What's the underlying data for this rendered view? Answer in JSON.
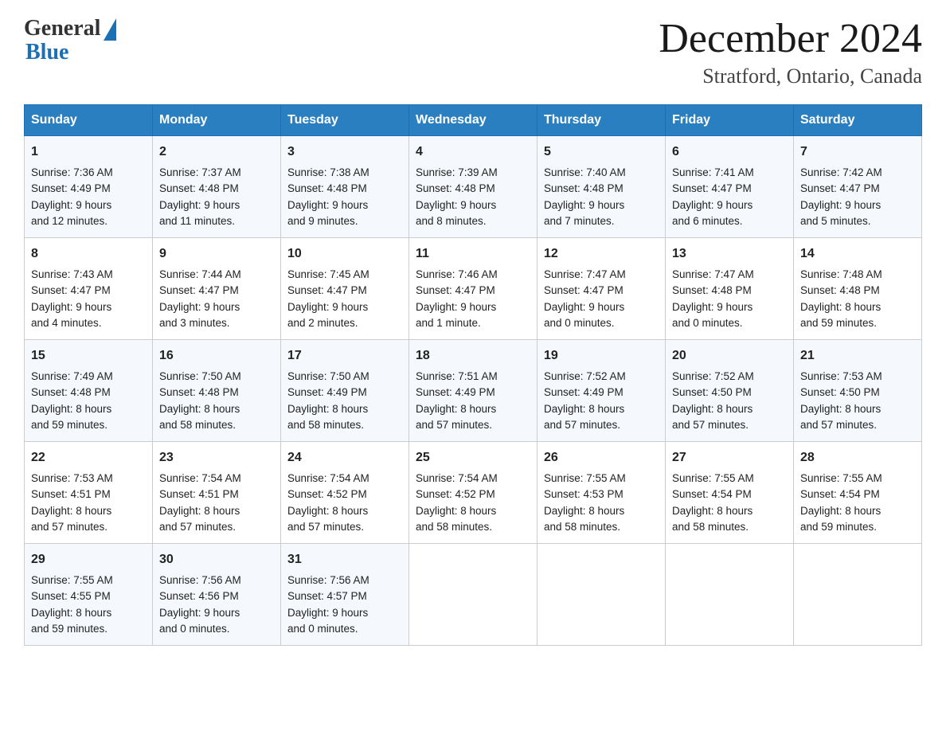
{
  "logo": {
    "general": "General",
    "blue": "Blue"
  },
  "title": {
    "month_year": "December 2024",
    "location": "Stratford, Ontario, Canada"
  },
  "days_of_week": [
    "Sunday",
    "Monday",
    "Tuesday",
    "Wednesday",
    "Thursday",
    "Friday",
    "Saturday"
  ],
  "weeks": [
    [
      {
        "day": "1",
        "sunrise": "7:36 AM",
        "sunset": "4:49 PM",
        "daylight": "9 hours and 12 minutes."
      },
      {
        "day": "2",
        "sunrise": "7:37 AM",
        "sunset": "4:48 PM",
        "daylight": "9 hours and 11 minutes."
      },
      {
        "day": "3",
        "sunrise": "7:38 AM",
        "sunset": "4:48 PM",
        "daylight": "9 hours and 9 minutes."
      },
      {
        "day": "4",
        "sunrise": "7:39 AM",
        "sunset": "4:48 PM",
        "daylight": "9 hours and 8 minutes."
      },
      {
        "day": "5",
        "sunrise": "7:40 AM",
        "sunset": "4:48 PM",
        "daylight": "9 hours and 7 minutes."
      },
      {
        "day": "6",
        "sunrise": "7:41 AM",
        "sunset": "4:47 PM",
        "daylight": "9 hours and 6 minutes."
      },
      {
        "day": "7",
        "sunrise": "7:42 AM",
        "sunset": "4:47 PM",
        "daylight": "9 hours and 5 minutes."
      }
    ],
    [
      {
        "day": "8",
        "sunrise": "7:43 AM",
        "sunset": "4:47 PM",
        "daylight": "9 hours and 4 minutes."
      },
      {
        "day": "9",
        "sunrise": "7:44 AM",
        "sunset": "4:47 PM",
        "daylight": "9 hours and 3 minutes."
      },
      {
        "day": "10",
        "sunrise": "7:45 AM",
        "sunset": "4:47 PM",
        "daylight": "9 hours and 2 minutes."
      },
      {
        "day": "11",
        "sunrise": "7:46 AM",
        "sunset": "4:47 PM",
        "daylight": "9 hours and 1 minute."
      },
      {
        "day": "12",
        "sunrise": "7:47 AM",
        "sunset": "4:47 PM",
        "daylight": "9 hours and 0 minutes."
      },
      {
        "day": "13",
        "sunrise": "7:47 AM",
        "sunset": "4:48 PM",
        "daylight": "9 hours and 0 minutes."
      },
      {
        "day": "14",
        "sunrise": "7:48 AM",
        "sunset": "4:48 PM",
        "daylight": "8 hours and 59 minutes."
      }
    ],
    [
      {
        "day": "15",
        "sunrise": "7:49 AM",
        "sunset": "4:48 PM",
        "daylight": "8 hours and 59 minutes."
      },
      {
        "day": "16",
        "sunrise": "7:50 AM",
        "sunset": "4:48 PM",
        "daylight": "8 hours and 58 minutes."
      },
      {
        "day": "17",
        "sunrise": "7:50 AM",
        "sunset": "4:49 PM",
        "daylight": "8 hours and 58 minutes."
      },
      {
        "day": "18",
        "sunrise": "7:51 AM",
        "sunset": "4:49 PM",
        "daylight": "8 hours and 57 minutes."
      },
      {
        "day": "19",
        "sunrise": "7:52 AM",
        "sunset": "4:49 PM",
        "daylight": "8 hours and 57 minutes."
      },
      {
        "day": "20",
        "sunrise": "7:52 AM",
        "sunset": "4:50 PM",
        "daylight": "8 hours and 57 minutes."
      },
      {
        "day": "21",
        "sunrise": "7:53 AM",
        "sunset": "4:50 PM",
        "daylight": "8 hours and 57 minutes."
      }
    ],
    [
      {
        "day": "22",
        "sunrise": "7:53 AM",
        "sunset": "4:51 PM",
        "daylight": "8 hours and 57 minutes."
      },
      {
        "day": "23",
        "sunrise": "7:54 AM",
        "sunset": "4:51 PM",
        "daylight": "8 hours and 57 minutes."
      },
      {
        "day": "24",
        "sunrise": "7:54 AM",
        "sunset": "4:52 PM",
        "daylight": "8 hours and 57 minutes."
      },
      {
        "day": "25",
        "sunrise": "7:54 AM",
        "sunset": "4:52 PM",
        "daylight": "8 hours and 58 minutes."
      },
      {
        "day": "26",
        "sunrise": "7:55 AM",
        "sunset": "4:53 PM",
        "daylight": "8 hours and 58 minutes."
      },
      {
        "day": "27",
        "sunrise": "7:55 AM",
        "sunset": "4:54 PM",
        "daylight": "8 hours and 58 minutes."
      },
      {
        "day": "28",
        "sunrise": "7:55 AM",
        "sunset": "4:54 PM",
        "daylight": "8 hours and 59 minutes."
      }
    ],
    [
      {
        "day": "29",
        "sunrise": "7:55 AM",
        "sunset": "4:55 PM",
        "daylight": "8 hours and 59 minutes."
      },
      {
        "day": "30",
        "sunrise": "7:56 AM",
        "sunset": "4:56 PM",
        "daylight": "9 hours and 0 minutes."
      },
      {
        "day": "31",
        "sunrise": "7:56 AM",
        "sunset": "4:57 PM",
        "daylight": "9 hours and 0 minutes."
      },
      null,
      null,
      null,
      null
    ]
  ],
  "labels": {
    "sunrise": "Sunrise:",
    "sunset": "Sunset:",
    "daylight": "Daylight:"
  }
}
